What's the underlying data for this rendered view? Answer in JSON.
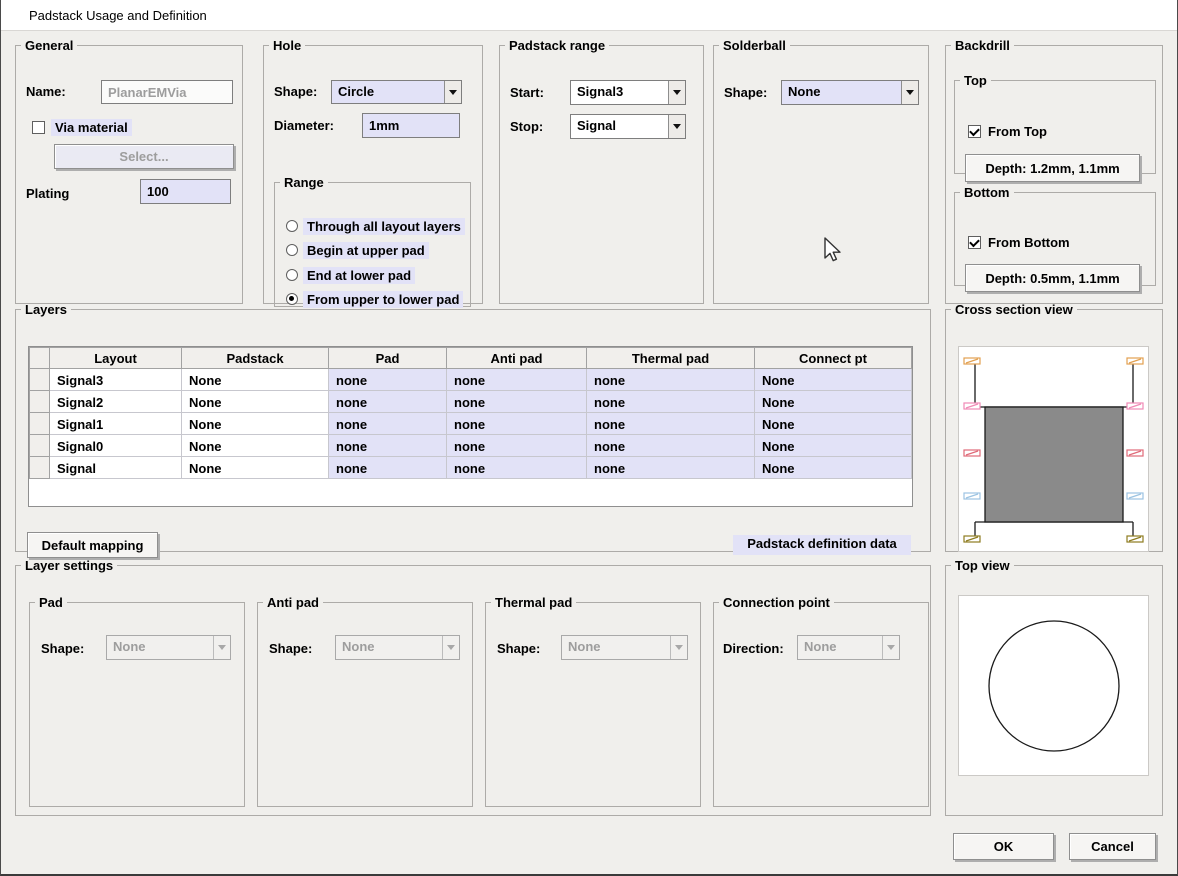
{
  "window": {
    "title": "Padstack Usage and Definition"
  },
  "general": {
    "title": "General",
    "name_label": "Name:",
    "name_value": "PlanarEMVia",
    "via_material_label": "Via material",
    "via_material_checked": false,
    "select_button": "Select...",
    "plating_label": "Plating",
    "plating_value": "100"
  },
  "hole": {
    "title": "Hole",
    "shape_label": "Shape:",
    "shape_value": "Circle",
    "diameter_label": "Diameter:",
    "diameter_value": "1mm",
    "range": {
      "title": "Range",
      "options": [
        {
          "label": "Through all layout layers",
          "selected": false
        },
        {
          "label": "Begin at upper pad",
          "selected": false
        },
        {
          "label": "End at lower pad",
          "selected": false
        },
        {
          "label": "From upper to lower pad",
          "selected": true
        }
      ]
    }
  },
  "padstack_range": {
    "title": "Padstack range",
    "start_label": "Start:",
    "start_value": "Signal3",
    "stop_label": "Stop:",
    "stop_value": "Signal"
  },
  "solderball": {
    "title": "Solderball",
    "shape_label": "Shape:",
    "shape_value": "None"
  },
  "backdrill": {
    "title": "Backdrill",
    "top": {
      "title": "Top",
      "checkbox_label": "From Top",
      "checked": true,
      "depth_button": "Depth: 1.2mm, 1.1mm"
    },
    "bottom": {
      "title": "Bottom",
      "checkbox_label": "From Bottom",
      "checked": true,
      "depth_button": "Depth: 0.5mm, 1.1mm"
    }
  },
  "layers": {
    "title": "Layers",
    "columns": [
      "Layout",
      "Padstack",
      "Pad",
      "Anti pad",
      "Thermal pad",
      "Connect pt"
    ],
    "rows": [
      {
        "layout": "Signal3",
        "padstack": "None",
        "pad": "none",
        "anti_pad": "none",
        "thermal_pad": "none",
        "connect_pt": "None"
      },
      {
        "layout": "Signal2",
        "padstack": "None",
        "pad": "none",
        "anti_pad": "none",
        "thermal_pad": "none",
        "connect_pt": "None"
      },
      {
        "layout": "Signal1",
        "padstack": "None",
        "pad": "none",
        "anti_pad": "none",
        "thermal_pad": "none",
        "connect_pt": "None"
      },
      {
        "layout": "Signal0",
        "padstack": "None",
        "pad": "none",
        "anti_pad": "none",
        "thermal_pad": "none",
        "connect_pt": "None"
      },
      {
        "layout": "Signal",
        "padstack": "None",
        "pad": "none",
        "anti_pad": "none",
        "thermal_pad": "none",
        "connect_pt": "None"
      }
    ],
    "default_mapping_button": "Default mapping",
    "padstack_definition_label": "Padstack definition data"
  },
  "cross_section": {
    "title": "Cross section view",
    "marker_colors": [
      "#e2a050",
      "#f08ab6",
      "#e06a78",
      "#9cc3e2",
      "#8e7c20"
    ],
    "barrel_fill": "#8a8a8a"
  },
  "layer_settings": {
    "title": "Layer settings",
    "pad": {
      "title": "Pad",
      "label": "Shape:",
      "value": "None"
    },
    "anti_pad": {
      "title": "Anti pad",
      "label": "Shape:",
      "value": "None"
    },
    "thermal_pad": {
      "title": "Thermal pad",
      "label": "Shape:",
      "value": "None"
    },
    "connection_point": {
      "title": "Connection point",
      "label": "Direction:",
      "value": "None"
    }
  },
  "top_view": {
    "title": "Top view"
  },
  "footer": {
    "ok_button": "OK",
    "cancel_button": "Cancel"
  },
  "colors": {
    "highlight": "#e2e2f7",
    "dialog_bg": "#f0efec",
    "disabled_text": "#9d9d9d"
  }
}
